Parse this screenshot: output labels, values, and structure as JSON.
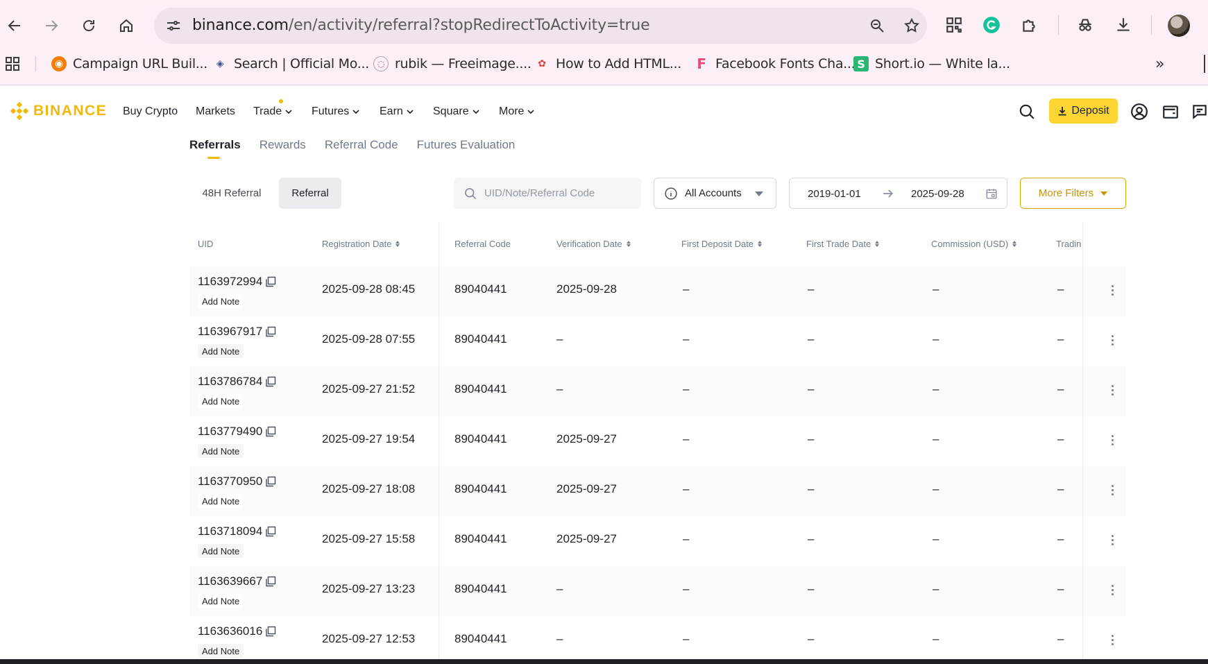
{
  "browser": {
    "url_host": "binance.com",
    "url_path": "/en/activity/referral?stopRedirectToActivity=true",
    "bookmarks": [
      {
        "label": "Campaign URL Buil..."
      },
      {
        "label": "Search | Official Mo..."
      },
      {
        "label": "rubik — Freeimage...."
      },
      {
        "label": "How to Add HTML..."
      },
      {
        "label": "Facebook Fonts Cha..."
      },
      {
        "label": "Short.io — White la..."
      }
    ]
  },
  "header": {
    "logo_text": "BINANCE",
    "nav": [
      "Buy Crypto",
      "Markets",
      "Trade",
      "Futures",
      "Earn",
      "Square",
      "More"
    ],
    "deposit_label": "Deposit",
    "colors": {
      "brand": "#f0b90b",
      "deposit_bg": "#fcd535"
    }
  },
  "tabs": [
    "Referrals",
    "Rewards",
    "Referral Code",
    "Futures Evaluation"
  ],
  "filters": {
    "segment_48h": "48H Referral",
    "segment_referral": "Referral",
    "search_placeholder": "UID/Note/Referral Code",
    "account": "All Accounts",
    "date_from": "2019-01-01",
    "date_to": "2025-09-28",
    "more_filters": "More Filters"
  },
  "table": {
    "columns": [
      "UID",
      "Registration Date",
      "Referral Code",
      "Verification Date",
      "First Deposit Date",
      "First Trade Date",
      "Commission (USD)",
      "Tradin"
    ],
    "add_note_label": "Add Note",
    "rows": [
      {
        "uid": "1163972994",
        "reg": "2025-09-28 08:45",
        "code": "89040441",
        "verif": "2025-09-28",
        "deposit": "–",
        "trade": "–",
        "commission": "–",
        "trading": "–"
      },
      {
        "uid": "1163967917",
        "reg": "2025-09-28 07:55",
        "code": "89040441",
        "verif": "–",
        "deposit": "–",
        "trade": "–",
        "commission": "–",
        "trading": "–"
      },
      {
        "uid": "1163786784",
        "reg": "2025-09-27 21:52",
        "code": "89040441",
        "verif": "–",
        "deposit": "–",
        "trade": "–",
        "commission": "–",
        "trading": "–"
      },
      {
        "uid": "1163779490",
        "reg": "2025-09-27 19:54",
        "code": "89040441",
        "verif": "2025-09-27",
        "deposit": "–",
        "trade": "–",
        "commission": "–",
        "trading": "–"
      },
      {
        "uid": "1163770950",
        "reg": "2025-09-27 18:08",
        "code": "89040441",
        "verif": "2025-09-27",
        "deposit": "–",
        "trade": "–",
        "commission": "–",
        "trading": "–"
      },
      {
        "uid": "1163718094",
        "reg": "2025-09-27 15:58",
        "code": "89040441",
        "verif": "2025-09-27",
        "deposit": "–",
        "trade": "–",
        "commission": "–",
        "trading": "–"
      },
      {
        "uid": "1163639667",
        "reg": "2025-09-27 13:23",
        "code": "89040441",
        "verif": "–",
        "deposit": "–",
        "trade": "–",
        "commission": "–",
        "trading": "–"
      },
      {
        "uid": "1163636016",
        "reg": "2025-09-27 12:53",
        "code": "89040441",
        "verif": "–",
        "deposit": "–",
        "trade": "–",
        "commission": "–",
        "trading": "–"
      }
    ]
  }
}
